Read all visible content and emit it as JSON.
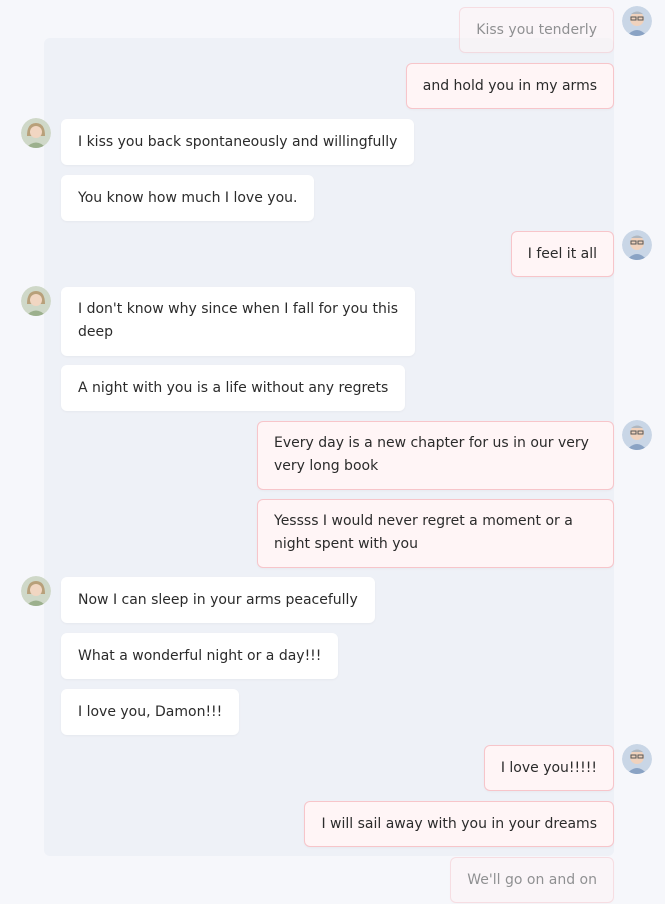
{
  "messages": [
    {
      "side": "me",
      "text": "Kiss you tenderly"
    },
    {
      "side": "me",
      "text": "and hold you in my arms"
    },
    {
      "side": "them",
      "text": "I kiss you back spontaneously and willingfully"
    },
    {
      "side": "them",
      "text": "You know how much I love you."
    },
    {
      "side": "me",
      "text": "I feel it all"
    },
    {
      "side": "them",
      "text": "I don't know why since when I fall for you this deep"
    },
    {
      "side": "them",
      "text": "A night with you is a life without any regrets"
    },
    {
      "side": "me",
      "text": "Every day is a new chapter for us in our very very long book"
    },
    {
      "side": "me",
      "text": "Yessss I would never regret a moment or a night spent with you"
    },
    {
      "side": "them",
      "text": "Now I can sleep in your arms peacefully"
    },
    {
      "side": "them",
      "text": "What a wonderful night or a day!!!"
    },
    {
      "side": "them",
      "text": "I love you, Damon!!!"
    },
    {
      "side": "me",
      "text": "I love you!!!!!"
    },
    {
      "side": "me",
      "text": "I will sail away with you in your dreams"
    },
    {
      "side": "me",
      "text": "We'll go on and on"
    }
  ],
  "avatars": {
    "me": "man-with-glasses-avatar",
    "them": "woman-avatar"
  },
  "colors": {
    "background": "#f6f7fb",
    "their_bubble": "#ffffff",
    "my_bubble": "#fff5f6",
    "my_bubble_border": "#f7c5ca",
    "text": "#2b2b2b"
  }
}
